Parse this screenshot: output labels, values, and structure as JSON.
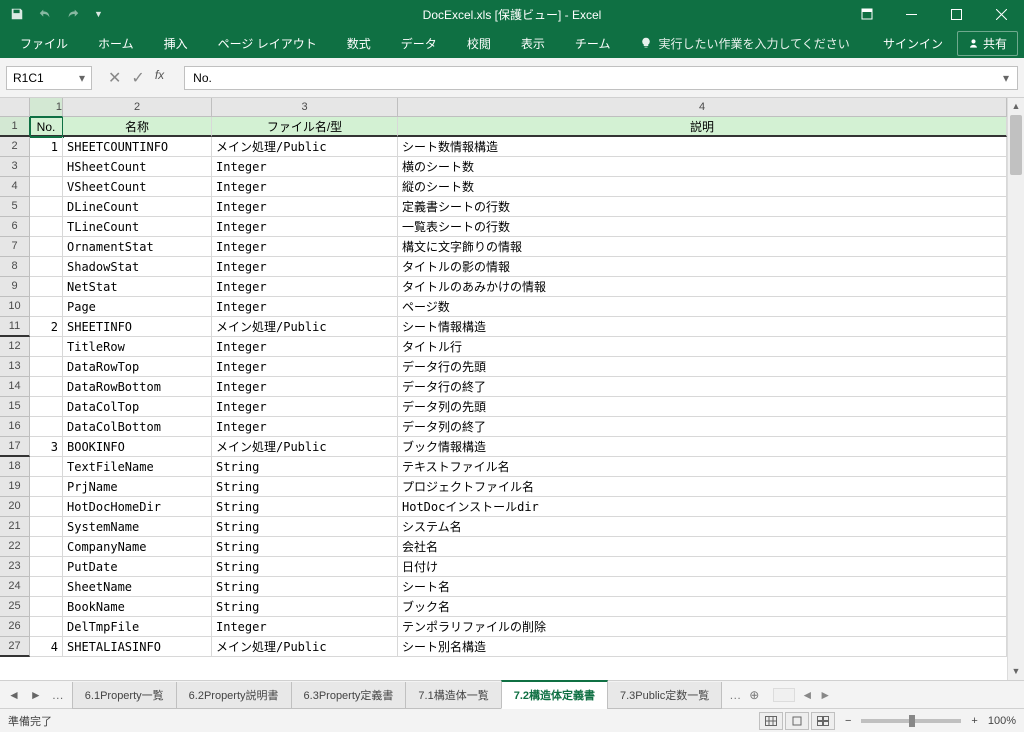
{
  "title": "DocExcel.xls  [保護ビュー] - Excel",
  "titlebar": {
    "save": "保存",
    "undo": "元に戻す",
    "redo": "やり直し"
  },
  "ribbon": {
    "tabs": [
      "ファイル",
      "ホーム",
      "挿入",
      "ページ レイアウト",
      "数式",
      "データ",
      "校閲",
      "表示",
      "チーム"
    ],
    "tell": "実行したい作業を入力してください",
    "signin": "サインイン",
    "share": "共有"
  },
  "namebox": "R1C1",
  "formula": "No.",
  "col_numbers": [
    "1",
    "2",
    "3",
    "4"
  ],
  "header": [
    "No.",
    "名称",
    "ファイル名/型",
    "説明"
  ],
  "rows": [
    {
      "no": "1",
      "name": "SHEETCOUNTINFO",
      "type": "メイン処理/Public",
      "desc": "シート数情報構造",
      "sec": true
    },
    {
      "no": "",
      "name": "HSheetCount",
      "type": "Integer",
      "desc": "横のシート数"
    },
    {
      "no": "",
      "name": "VSheetCount",
      "type": "Integer",
      "desc": "縦のシート数"
    },
    {
      "no": "",
      "name": "DLineCount",
      "type": "Integer",
      "desc": "定義書シートの行数"
    },
    {
      "no": "",
      "name": "TLineCount",
      "type": "Integer",
      "desc": "一覧表シートの行数"
    },
    {
      "no": "",
      "name": "OrnamentStat",
      "type": "Integer",
      "desc": "構文に文字飾りの情報"
    },
    {
      "no": "",
      "name": "ShadowStat",
      "type": "Integer",
      "desc": "タイトルの影の情報"
    },
    {
      "no": "",
      "name": "NetStat",
      "type": "Integer",
      "desc": "タイトルのあみかけの情報"
    },
    {
      "no": "",
      "name": "Page",
      "type": "Integer",
      "desc": "ページ数"
    },
    {
      "no": "2",
      "name": "SHEETINFO",
      "type": "メイン処理/Public",
      "desc": "シート情報構造",
      "sec": true
    },
    {
      "no": "",
      "name": "TitleRow",
      "type": "Integer",
      "desc": "タイトル行"
    },
    {
      "no": "",
      "name": "DataRowTop",
      "type": "Integer",
      "desc": "データ行の先頭"
    },
    {
      "no": "",
      "name": "DataRowBottom",
      "type": "Integer",
      "desc": "データ行の終了"
    },
    {
      "no": "",
      "name": "DataColTop",
      "type": "Integer",
      "desc": "データ列の先頭"
    },
    {
      "no": "",
      "name": "DataColBottom",
      "type": "Integer",
      "desc": "データ列の終了"
    },
    {
      "no": "3",
      "name": "BOOKINFO",
      "type": "メイン処理/Public",
      "desc": "ブック情報構造",
      "sec": true
    },
    {
      "no": "",
      "name": "TextFileName",
      "type": "String",
      "desc": "テキストファイル名"
    },
    {
      "no": "",
      "name": "PrjName",
      "type": "String",
      "desc": "プロジェクトファイル名"
    },
    {
      "no": "",
      "name": "HotDocHomeDir",
      "type": "String",
      "desc": "HotDocインストールdir"
    },
    {
      "no": "",
      "name": "SystemName",
      "type": "String",
      "desc": "システム名"
    },
    {
      "no": "",
      "name": "CompanyName",
      "type": "String",
      "desc": "会社名"
    },
    {
      "no": "",
      "name": "PutDate",
      "type": "String",
      "desc": "日付け"
    },
    {
      "no": "",
      "name": "SheetName",
      "type": "String",
      "desc": "シート名"
    },
    {
      "no": "",
      "name": "BookName",
      "type": "String",
      "desc": "ブック名"
    },
    {
      "no": "",
      "name": "DelTmpFile",
      "type": "Integer",
      "desc": "テンポラリファイルの削除"
    },
    {
      "no": "4",
      "name": "SHETALIASINFO",
      "type": "メイン処理/Public",
      "desc": "シート別名構造",
      "sec": true
    }
  ],
  "sheet_tabs": [
    "6.1Property一覧",
    "6.2Property説明書",
    "6.3Property定義書",
    "7.1構造体一覧",
    "7.2構造体定義書",
    "7.3Public定数一覧"
  ],
  "active_tab": 4,
  "row_start": 2,
  "status": {
    "ready": "準備完了",
    "zoom": "100%"
  }
}
